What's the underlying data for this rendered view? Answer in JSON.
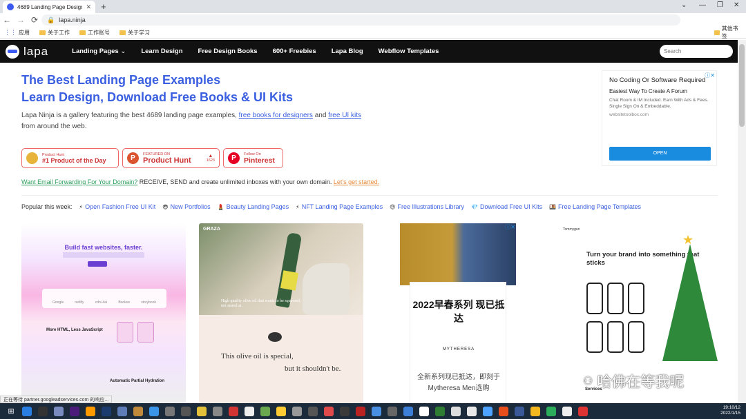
{
  "browser": {
    "tab_title": "4689 Landing Page Design Ins",
    "tab_close": "✕",
    "new_tab": "+",
    "url": "lapa.ninja",
    "win_min": "⌄",
    "win_restore": "—",
    "win_max": "❐",
    "win_close": "✕",
    "bookmarks": [
      "应用",
      "关于工作",
      "工作账号",
      "关于学习"
    ],
    "other_bookmarks": "其他书签"
  },
  "site": {
    "logo": "lapa",
    "nav": [
      "Landing Pages",
      "Learn Design",
      "Free Design Books",
      "600+ Freebies",
      "Lapa Blog",
      "Webflow Templates"
    ],
    "search_placeholder": "Search"
  },
  "hero": {
    "title_line1": "The Best Landing Page Examples",
    "title_line2": "Learn Design, Download Free Books & UI Kits",
    "intro_pre": "Lapa Ninja is a gallery featuring the best 4689 landing page examples, ",
    "intro_link1": "free books for designers",
    "intro_mid": " and ",
    "intro_link2": "free UI kits",
    "intro_post": " from around the web."
  },
  "badges": {
    "ph_day_small": "Product Hunt",
    "ph_day_big": "#1 Product of the Day",
    "ph_feat_small": "FEATURED ON",
    "ph_feat_big": "Product Hunt",
    "ph_votes": "1623",
    "pin_small": "Follow On",
    "pin_big": "Pinterest"
  },
  "promo": {
    "link": "Want Email Forwarding For Your Domain?",
    "text": " RECEIVE, SEND and create unlimited inboxes with your own domain. ",
    "cta": "Let's get started."
  },
  "popular": {
    "label": "Popular this week:",
    "items": [
      {
        "icon": "⚡",
        "text": "Open Fashion Free UI Kit"
      },
      {
        "icon": "😎",
        "text": "New Portfolios"
      },
      {
        "icon": "💄",
        "text": "Beauty Landing Pages"
      },
      {
        "icon": "⚡",
        "text": "NFT Landing Page Examples"
      },
      {
        "icon": "😍",
        "text": "Free Illustrations Library"
      },
      {
        "icon": "💎",
        "text": "Download Free UI Kits"
      },
      {
        "icon": "🍱",
        "text": "Free Landing Page Templates"
      }
    ]
  },
  "ad": {
    "marker": "ⓘ✕",
    "title": "No Coding Or Software Required",
    "subtitle": "Easiest Way To Create A Forum",
    "desc": "Chat Room & IM Included. Earn With Ads & Fees. Single Sign On & Embeddable.",
    "domain": "websitetoolbox.com",
    "button": "OPEN"
  },
  "cards": {
    "c1_title": "Build fast websites, faster.",
    "c1_logos": [
      "Google",
      "netlify",
      "cdn.i4ai",
      "Bookus",
      "storybook"
    ],
    "c1_h2": "More HTML, Less JavaScript",
    "c1_h3": "Automatic Partial Hydration",
    "c2_brand": "GRAZA",
    "c2_caption": "High quality olive oil that wants to be squeezed, not stared at.",
    "c2_text1": "This olive oil is special,",
    "c2_text2": "but it shouldn't be.",
    "c3_ad_marker": "ⓘ✕",
    "c3_cn1": "2022早春系列 现已抵达",
    "c3_logo": "MYTHERESA",
    "c3_cn2": "全新系列现已抵达，即刻于Mytheresa Men选购",
    "c4_logo": "Tommygun",
    "c4_heading": "Turn your brand into something that sticks",
    "c4_serv": "Services"
  },
  "status_text": "正在等待 partner.googleadservices.com 的响应...",
  "watermark": "哈佛在等我呢",
  "clock": {
    "time": "19:10/12",
    "date": "2022/1/15"
  }
}
